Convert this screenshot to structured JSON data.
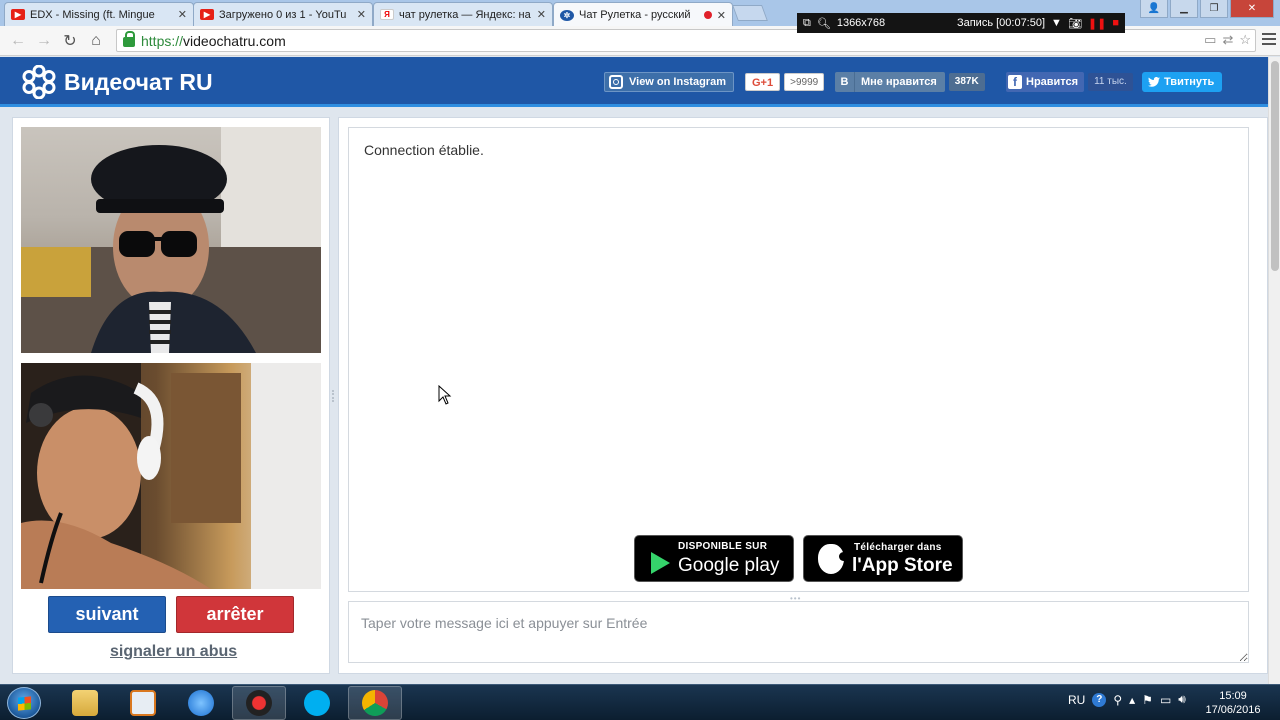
{
  "browser": {
    "tabs": [
      {
        "title": "EDX - Missing (ft. Mingue",
        "icon": "youtube-icon"
      },
      {
        "title": "Загружено 0 из 1 - YouTu",
        "icon": "youtube-icon"
      },
      {
        "title": "чат рулетка — Яндекс: на",
        "icon": "yandex-icon"
      },
      {
        "title": "Чат Рулетка - русский",
        "icon": "chatroulette-icon"
      }
    ],
    "url_scheme": "https://",
    "url_host": "videochatru.com"
  },
  "recorder": {
    "resolution": "1366x768",
    "status": "Запись [00:07:50]"
  },
  "site": {
    "logo_text": "Видеочат RU",
    "instagram_label": "View on Instagram",
    "gplus_label": "G+1",
    "gplus_count": ">9999",
    "vk_letter": "B",
    "vk_label": "Мне нравится",
    "vk_count": "387K",
    "fb_letter": "f",
    "fb_label": "Нравится",
    "fb_count": "11 тыс.",
    "twitter_label": "Твитнуть"
  },
  "controls": {
    "next_label": "suivant",
    "stop_label": "arrêter",
    "abuse_label": "signaler un abus"
  },
  "chat": {
    "status_message": "Connection établie.",
    "input_placeholder": "Taper votre message ici et appuyer sur Entrée"
  },
  "stores": {
    "google_small": "DISPONIBLE SUR",
    "google_big": "Google play",
    "apple_small": "Télécharger dans",
    "apple_big": "l'App Store"
  },
  "taskbar": {
    "lang": "RU",
    "time": "15:09",
    "date": "17/06/2016"
  },
  "colors": {
    "header_blue": "#1f57a6",
    "next_button": "#2461b3",
    "stop_button": "#d0363a"
  }
}
